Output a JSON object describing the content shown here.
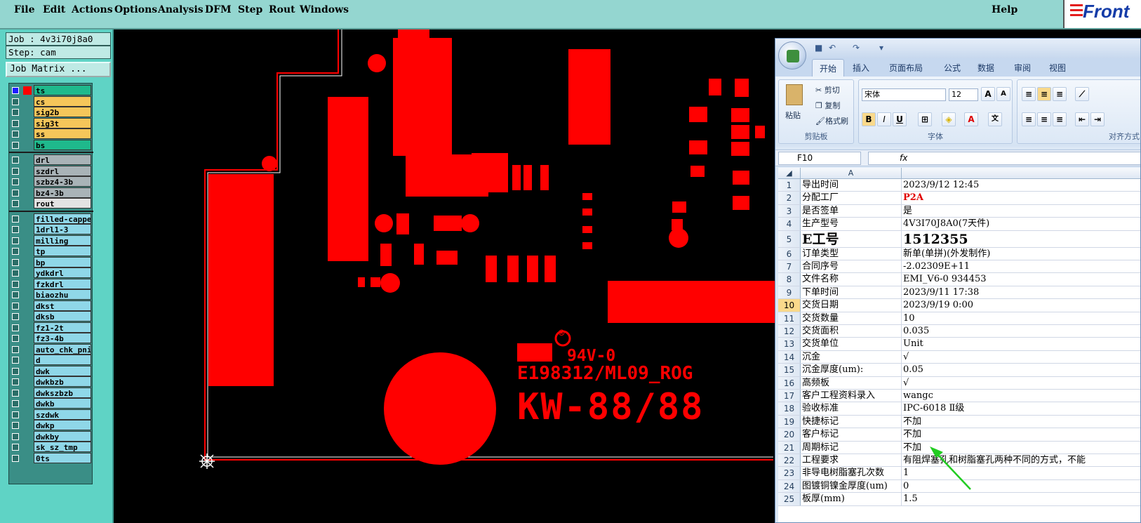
{
  "menu": {
    "items": [
      "File",
      "Edit",
      "Actions",
      "Options",
      "Analysis",
      "DFM",
      "Step",
      "Rout",
      "Windows"
    ],
    "help": "Help",
    "logo": "Front"
  },
  "job": {
    "job_label": "Job : 4v3i70j8a0",
    "step_label": "Step: cam",
    "matrix_button": "Job Matrix ..."
  },
  "layers": {
    "group1": [
      {
        "name": "ts",
        "color": "#1fb98c",
        "active": true
      },
      {
        "name": "cs",
        "color": "#f5c65a"
      },
      {
        "name": "sig2b",
        "color": "#f5c65a"
      },
      {
        "name": "sig3t",
        "color": "#f5c65a"
      },
      {
        "name": "ss",
        "color": "#f5c65a"
      },
      {
        "name": "bs",
        "color": "#1fb98c"
      }
    ],
    "group2": [
      {
        "name": "drl",
        "color": "#a9b3b7"
      },
      {
        "name": "szdrl",
        "color": "#a9b3b7"
      },
      {
        "name": "szbz4-3b",
        "color": "#a9b3b7"
      },
      {
        "name": "bz4-3b",
        "color": "#a9b3b7"
      },
      {
        "name": "rout",
        "color": "#e3e3e3"
      }
    ],
    "group3": [
      {
        "name": "filled-cappe",
        "color": "#8fd7e8"
      },
      {
        "name": "1drl1-3",
        "color": "#8fd7e8"
      },
      {
        "name": "milling",
        "color": "#8fd7e8"
      },
      {
        "name": "tp",
        "color": "#8fd7e8"
      },
      {
        "name": "bp",
        "color": "#8fd7e8"
      },
      {
        "name": "ydkdrl",
        "color": "#8fd7e8"
      },
      {
        "name": "fzkdrl",
        "color": "#8fd7e8"
      },
      {
        "name": "biaozhu",
        "color": "#8fd7e8"
      },
      {
        "name": "dkst",
        "color": "#8fd7e8"
      },
      {
        "name": "dksb",
        "color": "#8fd7e8"
      },
      {
        "name": "fz1-2t",
        "color": "#8fd7e8"
      },
      {
        "name": "fz3-4b",
        "color": "#8fd7e8"
      },
      {
        "name": "auto_chk_pni",
        "color": "#8fd7e8"
      },
      {
        "name": "d",
        "color": "#8fd7e8"
      },
      {
        "name": "dwk",
        "color": "#8fd7e8"
      },
      {
        "name": "dwkbzb",
        "color": "#8fd7e8"
      },
      {
        "name": "dwkszbzb",
        "color": "#8fd7e8"
      },
      {
        "name": "dwkb",
        "color": "#8fd7e8"
      },
      {
        "name": "szdwk",
        "color": "#8fd7e8"
      },
      {
        "name": "dwkp",
        "color": "#8fd7e8"
      },
      {
        "name": "dwkby",
        "color": "#8fd7e8"
      },
      {
        "name": "sk_sz_tmp",
        "color": "#8fd7e8"
      },
      {
        "name": "0ts",
        "color": "#8fd7e8"
      }
    ]
  },
  "silkscreen": {
    "rating": "94V-0",
    "ul_mark": "®",
    "code": "E198312/ML09_ROG",
    "model": "KW-88/88"
  },
  "excel": {
    "tabs": [
      "开始",
      "插入",
      "页面布局",
      "公式",
      "数据",
      "审阅",
      "视图"
    ],
    "clipboard": {
      "paste": "粘贴",
      "cut": "剪切",
      "copy": "复制",
      "format_painter": "格式刷",
      "label": "剪贴板"
    },
    "font": {
      "name": "宋体",
      "size": "12",
      "label": "字体",
      "bold": "B",
      "italic": "I",
      "underline": "U"
    },
    "align_label": "对齐方式",
    "name_box": "F10",
    "fx": "fx",
    "col_a": "A",
    "rows": [
      {
        "n": "1",
        "a": "导出时间",
        "b": "2023/9/12 12:45"
      },
      {
        "n": "2",
        "a": "分配工厂",
        "b": "P2A",
        "red": true
      },
      {
        "n": "3",
        "a": "是否签单",
        "b": "是"
      },
      {
        "n": "4",
        "a": "生产型号",
        "b": "4V3I70J8A0(7天件)"
      },
      {
        "n": "5",
        "a": "E工号",
        "b": "1512355",
        "big": true
      },
      {
        "n": "6",
        "a": "订单类型",
        "b": "新单(单拼)(外发制作)"
      },
      {
        "n": "7",
        "a": "合同序号",
        "b": "-2.02309E+11"
      },
      {
        "n": "8",
        "a": "文件名称",
        "b": "EMI_V6-0 934453"
      },
      {
        "n": "9",
        "a": "下单时间",
        "b": "2023/9/11 17:38"
      },
      {
        "n": "10",
        "a": "交货日期",
        "b": "2023/9/19 0:00",
        "sel": true
      },
      {
        "n": "11",
        "a": "交货数量",
        "b": "10"
      },
      {
        "n": "12",
        "a": "交货面积",
        "b": "0.035"
      },
      {
        "n": "13",
        "a": "交货单位",
        "b": "Unit"
      },
      {
        "n": "14",
        "a": "沉金",
        "b": "√"
      },
      {
        "n": "15",
        "a": "沉金厚度(um):",
        "b": "0.05"
      },
      {
        "n": "16",
        "a": "高频板",
        "b": "√"
      },
      {
        "n": "17",
        "a": "客户工程资料录入",
        "b": "wangc"
      },
      {
        "n": "18",
        "a": "验收标准",
        "b": "IPC-6018 Ⅱ级"
      },
      {
        "n": "19",
        "a": "快捷标记",
        "b": "不加"
      },
      {
        "n": "20",
        "a": "客户标记",
        "b": "不加"
      },
      {
        "n": "21",
        "a": "周期标记",
        "b": "不加"
      },
      {
        "n": "22",
        "a": "工程要求",
        "b": "有阻焊塞孔和树脂塞孔两种不同的方式，不能"
      },
      {
        "n": "23",
        "a": "非导电树脂塞孔次数",
        "b": "1"
      },
      {
        "n": "24",
        "a": "图镀铜镍金厚度(um)",
        "b": "0"
      },
      {
        "n": "25",
        "a": "板厚(mm)",
        "b": "1.5"
      }
    ]
  },
  "colors": {
    "menubar": "#94d6d0",
    "copper": "#ff0000",
    "panel": "#5fd3c5",
    "arrow": "#22cc22"
  }
}
